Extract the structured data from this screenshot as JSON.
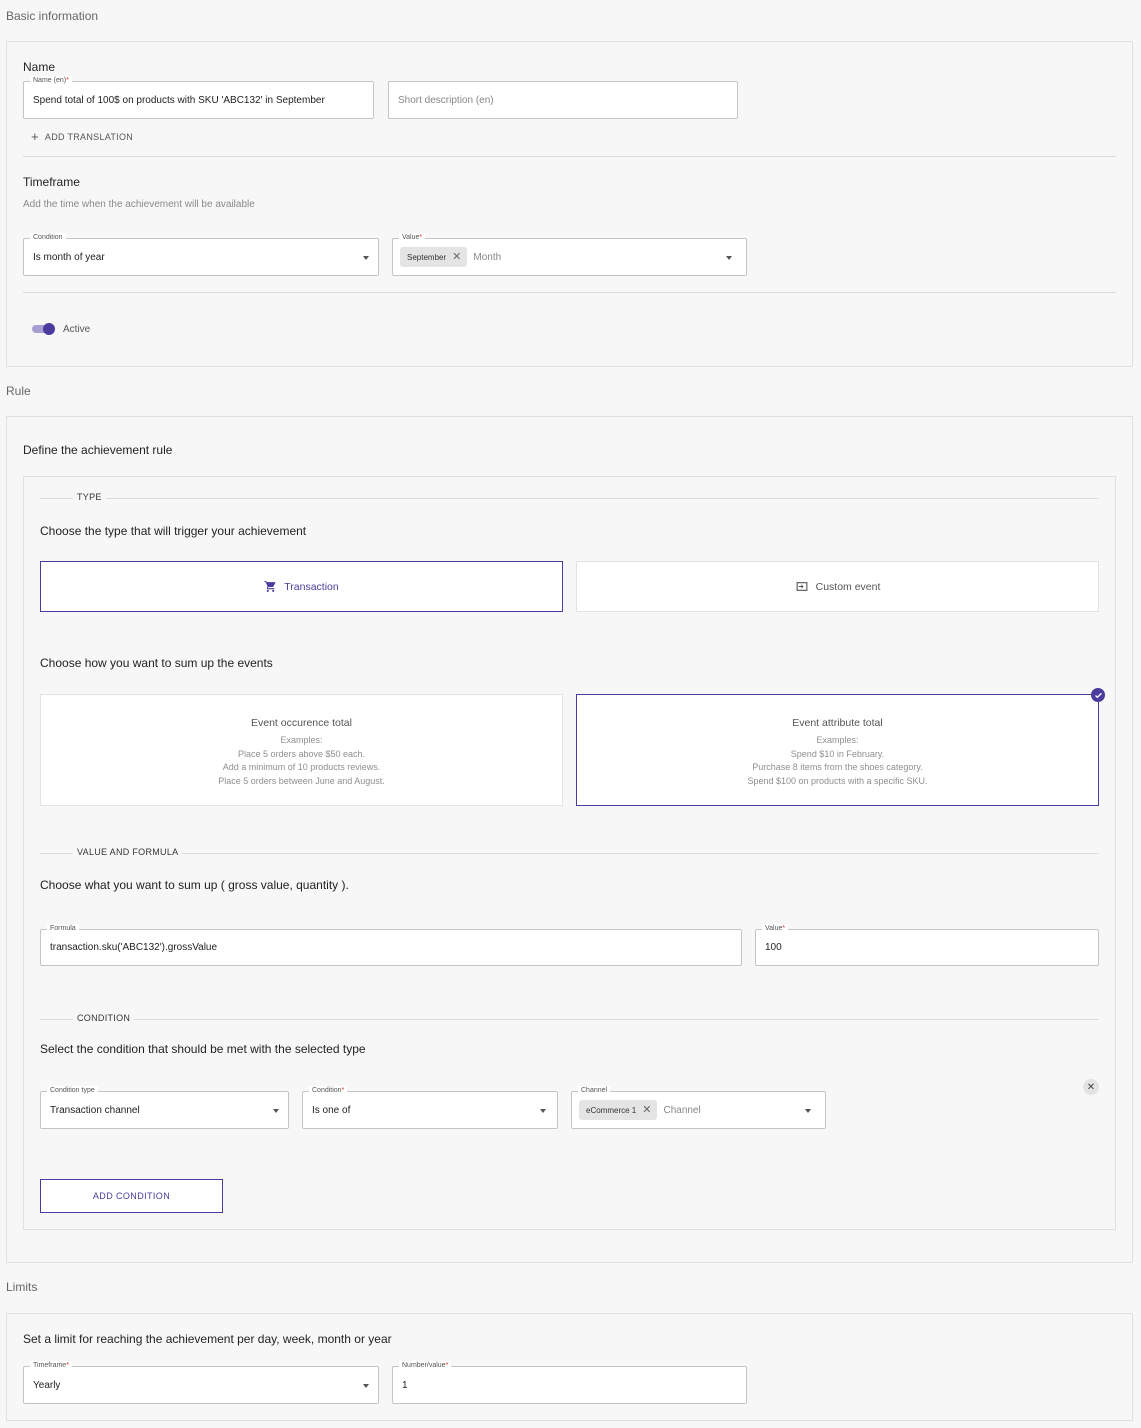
{
  "basic": {
    "section_title": "Basic information",
    "name_heading": "Name",
    "name_field_label": "Name (en)",
    "name_field_value": "Spend total of 100$ on products with SKU 'ABC132' in September",
    "short_desc_placeholder": "Short description (en)",
    "add_translation": "ADD TRANSLATION",
    "timeframe_heading": "Timeframe",
    "timeframe_sub": "Add the time when the achievement will be available",
    "condition_label": "Condition",
    "condition_value": "Is month of year",
    "value_label": "Value",
    "value_chip": "September",
    "value_placeholder": "Month",
    "active_label": "Active",
    "active_on": true
  },
  "rule": {
    "section_title": "Rule",
    "heading": "Define the achievement rule",
    "type_legend": "TYPE",
    "type_prompt": "Choose the type that will trigger your achievement",
    "type_options": [
      {
        "label": "Transaction",
        "icon": "cart-icon",
        "selected": true
      },
      {
        "label": "Custom event",
        "icon": "login-icon",
        "selected": false
      }
    ],
    "sum_prompt": "Choose how you want to sum up the events",
    "sum_options": [
      {
        "title": "Event occurence total",
        "examples_label": "Examples:",
        "lines": [
          "Place 5 orders above $50 each.",
          "Add a minimum of 10 products reviews.",
          "Place 5 orders between June and August."
        ],
        "selected": false
      },
      {
        "title": "Event attribute total",
        "examples_label": "Examples:",
        "lines": [
          "Spend $10 in February.",
          "Purchase 8 items from the shoes category.",
          "Spend $100 on products with a specific SKU."
        ],
        "selected": true
      }
    ],
    "value_legend": "VALUE AND FORMULA",
    "value_prompt": "Choose what you want to sum up ( gross value, quantity ).",
    "formula_label": "Formula",
    "formula_value": "transaction.sku('ABC132').grossValue",
    "value_label": "Value",
    "value_value": "100",
    "condition_legend": "CONDITION",
    "condition_prompt": "Select the condition that should be met with the selected type",
    "condition_type_label": "Condition type",
    "condition_type_value": "Transaction channel",
    "condition_label": "Condition",
    "condition_value": "Is one of",
    "channel_label": "Channel",
    "channel_chip": "eCommerce 1",
    "channel_placeholder": "Channel",
    "add_condition": "ADD CONDITION"
  },
  "limits": {
    "section_title": "Limits",
    "heading": "Set a limit for reaching the achievement per day, week, month or year",
    "timeframe_label": "Timeframe",
    "timeframe_value": "Yearly",
    "number_label": "Number/value",
    "number_value": "1"
  },
  "colors": {
    "accent": "#4a3c9c",
    "required": "#d32f2f"
  }
}
